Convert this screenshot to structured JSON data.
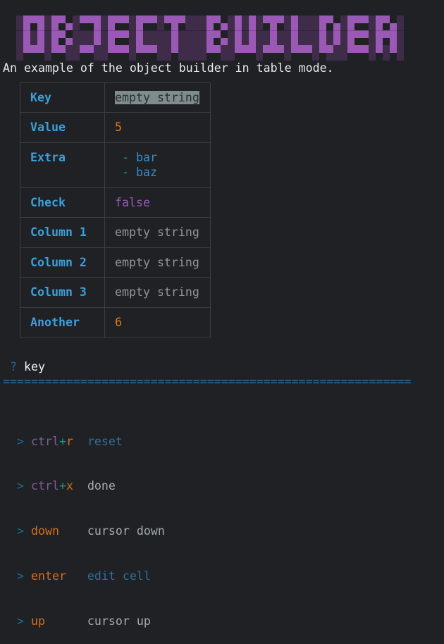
{
  "banner": {
    "text": "OBJECT BUILDER",
    "colors": {
      "foreground": "#9b59b6",
      "shadow": "#3e2c48"
    }
  },
  "subtitle": "An example of the object builder in table mode.",
  "table": {
    "rows": [
      {
        "key": "Key",
        "value": "empty string",
        "type": "selected"
      },
      {
        "key": "Value",
        "value": "5",
        "type": "number"
      },
      {
        "key": "Extra",
        "value": [
          "bar",
          "baz"
        ],
        "type": "list"
      },
      {
        "key": "Check",
        "value": "false",
        "type": "boolean"
      },
      {
        "key": "Column 1",
        "value": "empty string",
        "type": "empty"
      },
      {
        "key": "Column 2",
        "value": "empty string",
        "type": "empty"
      },
      {
        "key": "Column 3",
        "value": "empty string",
        "type": "empty"
      },
      {
        "key": "Another",
        "value": "6",
        "type": "number"
      }
    ],
    "list_bullet": "-"
  },
  "prompt": {
    "symbol": "?",
    "input": "key",
    "rule": "=========================================================="
  },
  "help": {
    "arrow": ">",
    "items": [
      {
        "mod": "ctrl",
        "plus": "+",
        "key": "r",
        "desc": "reset",
        "desc_style": "blue"
      },
      {
        "mod": "ctrl",
        "plus": "+",
        "key": "x",
        "desc": "done",
        "desc_style": "grey"
      },
      {
        "mod": "",
        "plus": "",
        "key": "down",
        "desc": "cursor down",
        "desc_style": "grey"
      },
      {
        "mod": "",
        "plus": "",
        "key": "enter",
        "desc": "edit cell",
        "desc_style": "blue"
      },
      {
        "mod": "",
        "plus": "",
        "key": "up",
        "desc": "cursor up",
        "desc_style": "grey"
      }
    ]
  }
}
